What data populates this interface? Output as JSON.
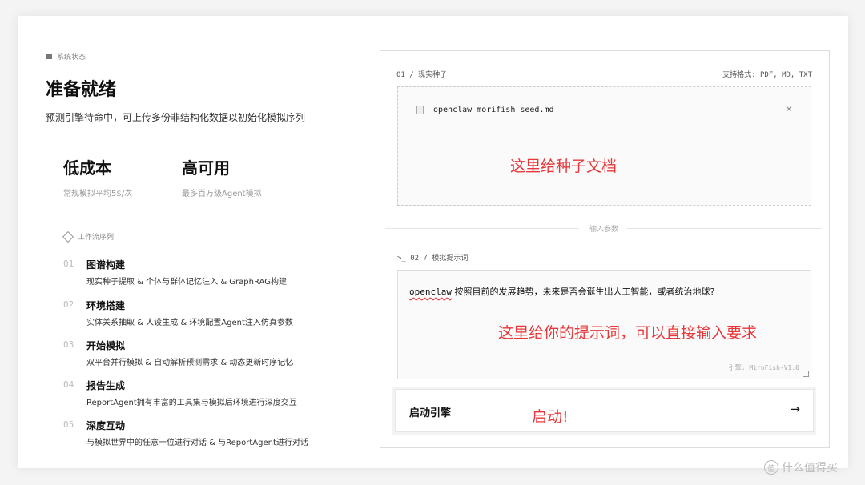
{
  "left": {
    "status_label": "系统状态",
    "title": "准备就绪",
    "subtitle": "预测引擎待命中，可上传多份非结构化数据以初始化模拟序列",
    "features": [
      {
        "title": "低成本",
        "sub": "常规模拟平均5$/次"
      },
      {
        "title": "高可用",
        "sub": "最多百万级Agent模拟"
      }
    ],
    "workflow_label": "工作流序列",
    "steps": [
      {
        "num": "01",
        "title": "图谱构建",
        "desc": "现实种子提取 & 个体与群体记忆注入 & GraphRAG构建"
      },
      {
        "num": "02",
        "title": "环境搭建",
        "desc": "实体关系抽取 & 人设生成 & 环境配置Agent注入仿真参数"
      },
      {
        "num": "03",
        "title": "开始模拟",
        "desc": "双平台并行模拟 & 自动解析预测需求 & 动态更新时序记忆"
      },
      {
        "num": "04",
        "title": "报告生成",
        "desc": "ReportAgent拥有丰富的工具集与模拟后环境进行深度交互"
      },
      {
        "num": "05",
        "title": "深度互动",
        "desc": "与模拟世界中的任意一位进行对话 & 与ReportAgent进行对话"
      }
    ]
  },
  "upload": {
    "label": "01 / 现实种子",
    "formats": "支持格式: PDF, MD, TXT",
    "file_name": "openclaw_morifish_seed.md",
    "close": "×",
    "annotation": "这里给种子文档"
  },
  "divider_text": "输入参数",
  "prompt": {
    "label": ">_ 02 / 模拟提示词",
    "keyword": "openclaw",
    "text": " 按照目前的发展趋势，未来是否会诞生出人工智能，或者统治地球?",
    "annotation": "这里给你的提示词，可以直接输入要求",
    "engine": "引擎: MiroFish-V1.0"
  },
  "start": {
    "label": "启动引擎",
    "annotation": "启动!",
    "arrow": "→"
  },
  "watermark": {
    "icon": "值",
    "text": "什么值得买"
  }
}
